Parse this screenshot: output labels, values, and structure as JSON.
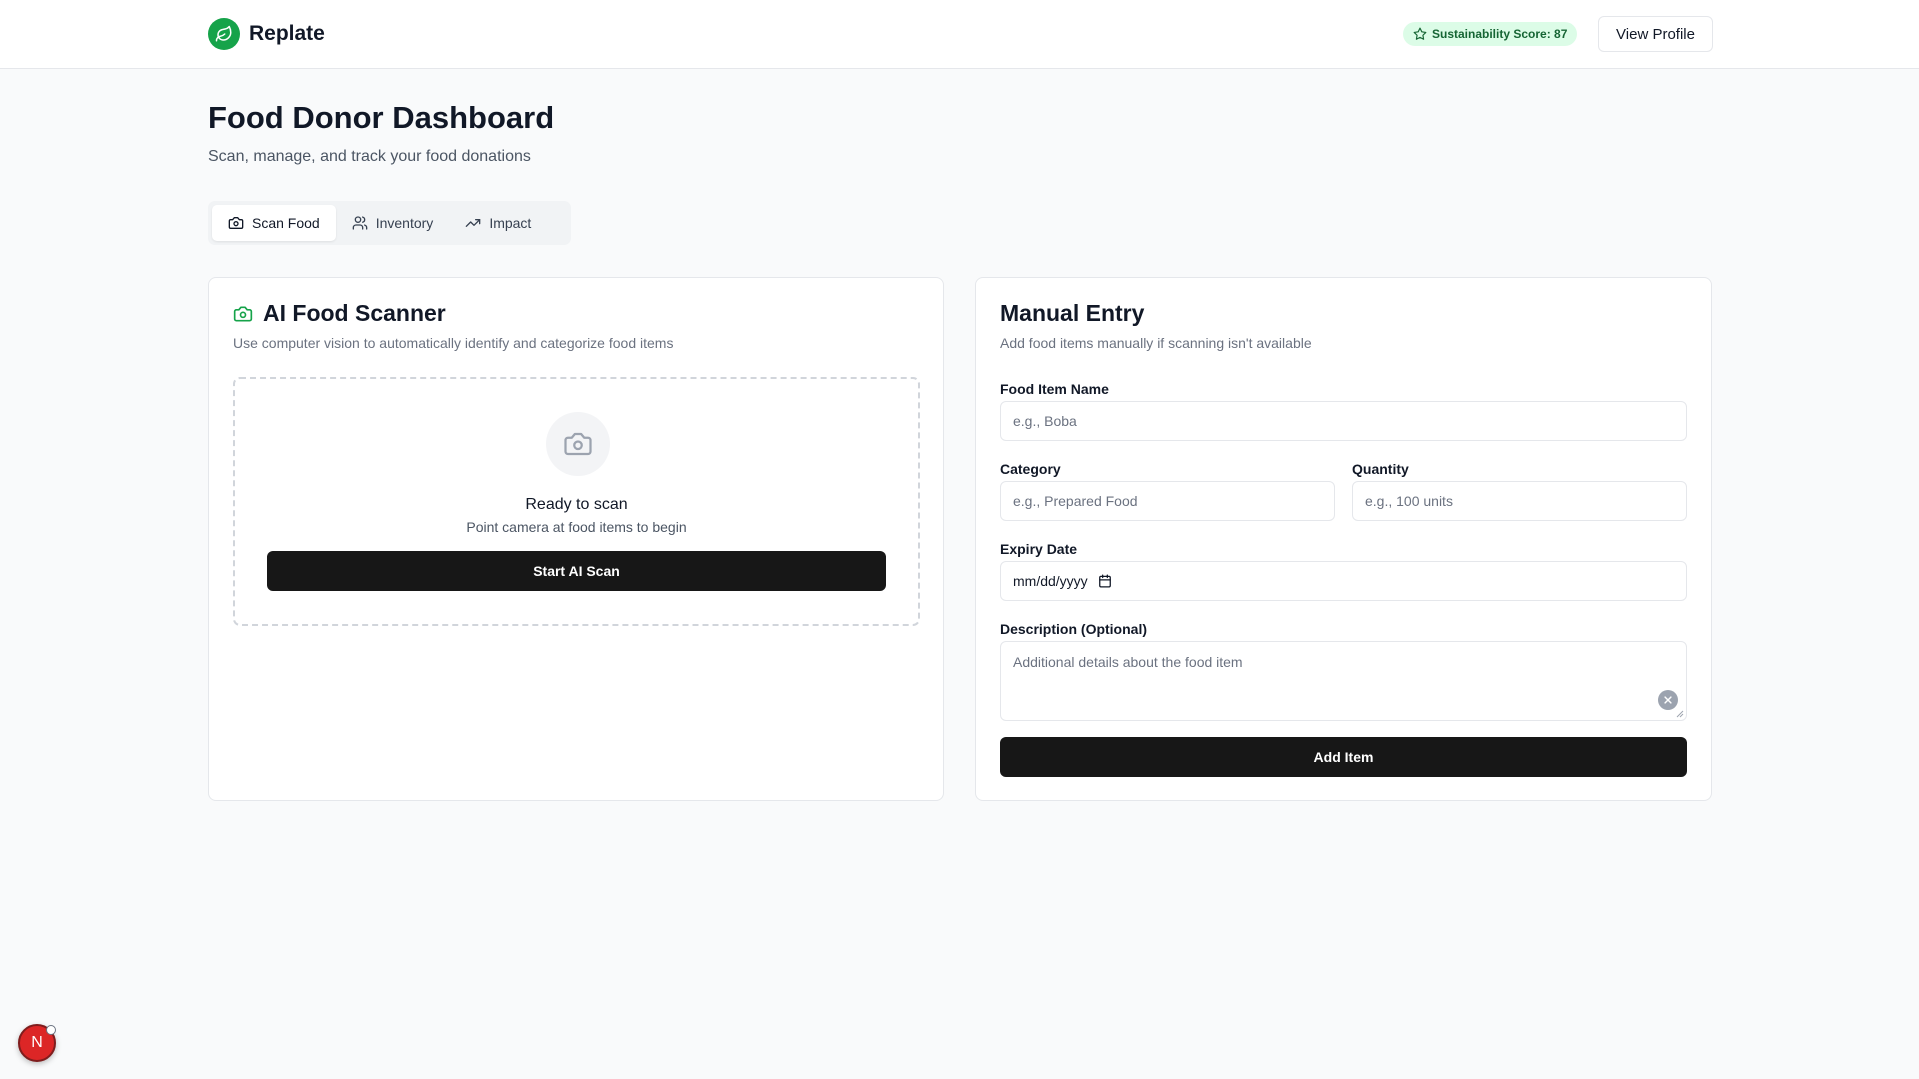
{
  "header": {
    "brand": "Replate",
    "score_badge": "Sustainability Score: 87",
    "view_profile": "View Profile"
  },
  "page": {
    "title": "Food Donor Dashboard",
    "subtitle": "Scan, manage, and track your food donations"
  },
  "tabs": [
    {
      "label": "Scan Food",
      "icon": "camera-icon",
      "active": true
    },
    {
      "label": "Inventory",
      "icon": "users-icon",
      "active": false
    },
    {
      "label": "Impact",
      "icon": "trending-up-icon",
      "active": false
    }
  ],
  "scanner": {
    "title": "AI Food Scanner",
    "description": "Use computer vision to automatically identify and categorize food items",
    "ready": "Ready to scan",
    "hint": "Point camera at food items to begin",
    "button": "Start AI Scan"
  },
  "manual": {
    "title": "Manual Entry",
    "description": "Add food items manually if scanning isn't available",
    "name_label": "Food Item Name",
    "name_placeholder": "e.g., Boba",
    "category_label": "Category",
    "category_placeholder": "e.g., Prepared Food",
    "quantity_label": "Quantity",
    "quantity_placeholder": "e.g., 100 units",
    "expiry_label": "Expiry Date",
    "expiry_value": "mm/dd/yyyy",
    "description_label": "Description (Optional)",
    "description_placeholder": "Additional details about the food item",
    "button": "Add Item"
  },
  "dev_badge": "N",
  "colors": {
    "brand": "#16a34a",
    "badge_bg": "#dcfce7",
    "badge_text": "#166534",
    "button_dark": "#171717",
    "dev_badge": "#dc2626"
  }
}
